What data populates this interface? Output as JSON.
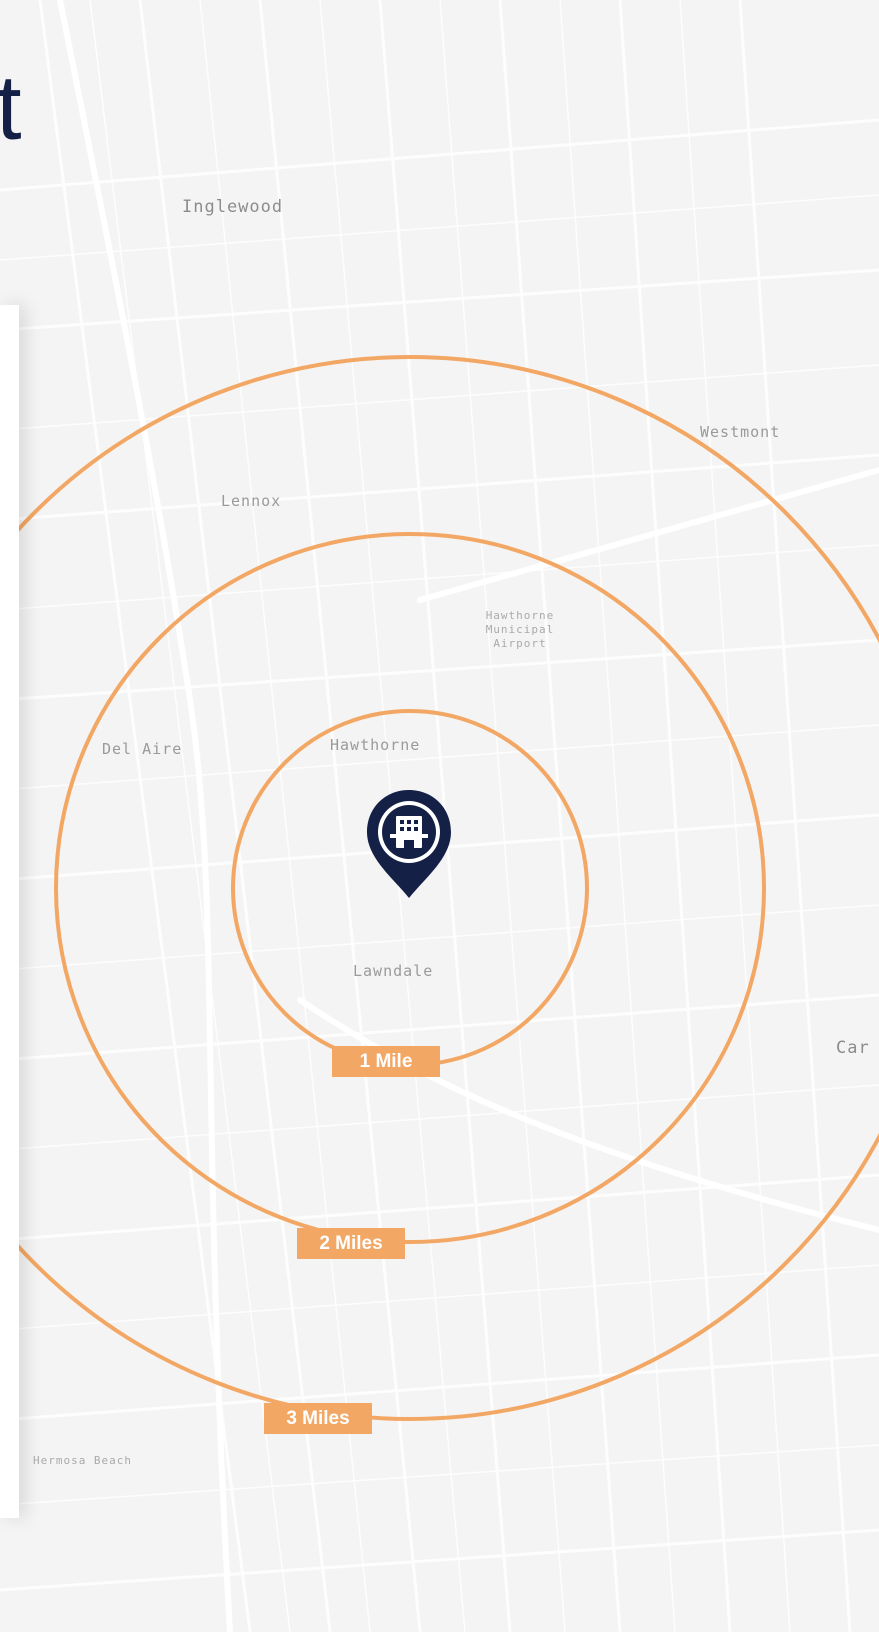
{
  "title_fragment": "t",
  "colors": {
    "ring": "#f3a764",
    "label_bg": "#f3a764",
    "label_text": "#ffffff",
    "pin": "#142046",
    "map_bg": "#f4f4f4",
    "road": "#ffffff"
  },
  "marker": {
    "icon": "building-pin-icon"
  },
  "places": {
    "inglewood": "Inglewood",
    "westmont": "Westmont",
    "lennox": "Lennox",
    "hawthorne_airport": "Hawthorne Municipal Airport",
    "del_aire": "Del Aire",
    "hawthorne": "Hawthorne",
    "lawndale": "Lawndale",
    "carson": "Car",
    "hermosa_beach": "Hermosa Beach"
  },
  "radii": [
    {
      "label": "1 Mile",
      "miles": 1
    },
    {
      "label": "2 Miles",
      "miles": 2
    },
    {
      "label": "3 Miles",
      "miles": 3
    }
  ]
}
